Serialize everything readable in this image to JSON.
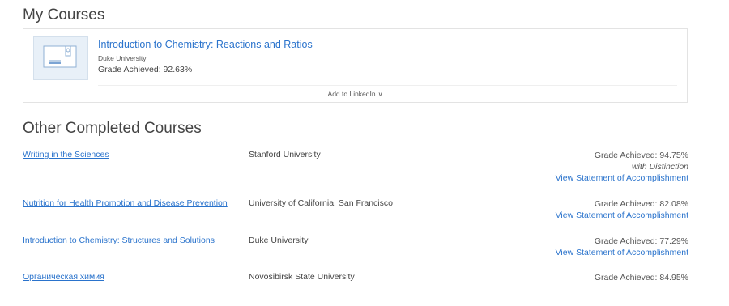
{
  "my_courses": {
    "title": "My Courses",
    "card": {
      "icon": "certificate-icon",
      "course_title": "Introduction to Chemistry: Reactions and Ratios",
      "organization": "Duke University",
      "grade": "Grade Achieved: 92.63%",
      "add_linkedin_label": "Add to LinkedIn",
      "add_linkedin_chevron": "∨"
    }
  },
  "other_completed": {
    "title": "Other Completed Courses",
    "rows": [
      {
        "course": "Writing in the Sciences",
        "organization": "Stanford University",
        "grade": "Grade Achieved: 94.75%",
        "distinction": "with Distinction",
        "statement": "View Statement of Accomplishment"
      },
      {
        "course": "Nutrition for Health Promotion and Disease Prevention",
        "organization": "University of California, San Francisco",
        "grade": "Grade Achieved: 82.08%",
        "statement": "View Statement of Accomplishment"
      },
      {
        "course": "Introduction to Chemistry: Structures and Solutions",
        "organization": "Duke University",
        "grade": "Grade Achieved: 77.29%",
        "statement": "View Statement of Accomplishment"
      },
      {
        "course": "Органическая химия",
        "organization": "Novosibirsk State University",
        "grade": "Grade Achieved: 84.95%"
      }
    ]
  },
  "colors": {
    "link": "#2a73cc",
    "text": "#444444",
    "border": "#e3e3e3",
    "thumb_bg": "#e8f0f8"
  }
}
